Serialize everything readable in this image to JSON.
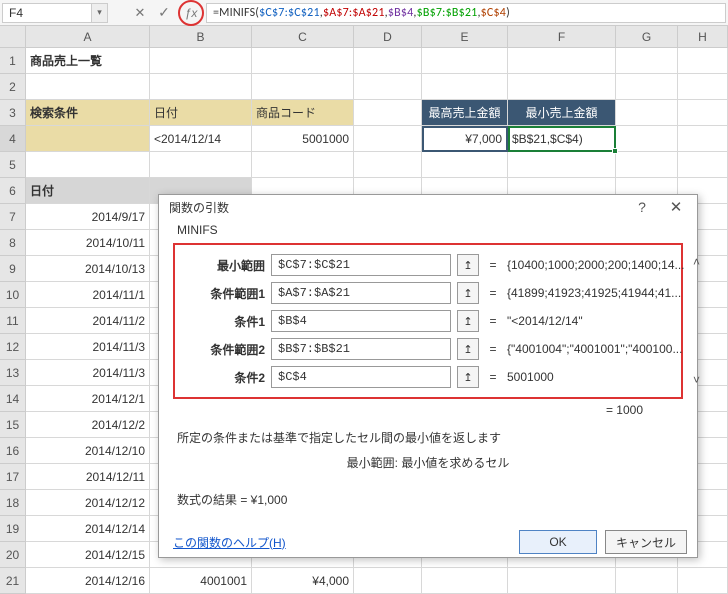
{
  "namebox": "F4",
  "formula_parts": {
    "prefix": "=MINIFS(",
    "a1": "$C$7:$C$21",
    "a2": "$A$7:$A$21",
    "a3": "$B$4",
    "a4": "$B$7:$B$21",
    "a5": "$C$4",
    "suffix": ")"
  },
  "columns": [
    "A",
    "B",
    "C",
    "D",
    "E",
    "F",
    "G",
    "H"
  ],
  "rows": {
    "1": {
      "A": "商品売上一覧"
    },
    "2": {},
    "3": {
      "A": "検索条件",
      "B": "日付",
      "C": "商品コード",
      "E": "最高売上金額",
      "F": "最小売上金額"
    },
    "4": {
      "B": "<2014/12/14",
      "C": "5001000",
      "E": "¥7,000",
      "F": "$B$21,$C$4)"
    },
    "5": {},
    "6": {
      "A": "日付"
    },
    "7": {
      "A": "2014/9/17"
    },
    "8": {
      "A": "2014/10/11"
    },
    "9": {
      "A": "2014/10/13"
    },
    "10": {
      "A": "2014/11/1"
    },
    "11": {
      "A": "2014/11/2"
    },
    "12": {
      "A": "2014/11/3"
    },
    "13": {
      "A": "2014/11/3"
    },
    "14": {
      "A": "2014/12/1"
    },
    "15": {
      "A": "2014/12/2"
    },
    "16": {
      "A": "2014/12/10"
    },
    "17": {
      "A": "2014/12/11"
    },
    "18": {
      "A": "2014/12/12"
    },
    "19": {
      "A": "2014/12/14"
    },
    "20": {
      "A": "2014/12/15"
    },
    "21": {
      "A": "2014/12/16",
      "B": "4001001",
      "C": "¥4,000"
    }
  },
  "dialog": {
    "title": "関数の引数",
    "func": "MINIFS",
    "args": [
      {
        "label": "最小範囲",
        "value": "$C$7:$C$21",
        "eval": "{10400;1000;2000;200;1400;14...",
        "chev": "up"
      },
      {
        "label": "条件範囲1",
        "value": "$A$7:$A$21",
        "eval": "{41899;41923;41925;41944;41..."
      },
      {
        "label": "条件1",
        "value": "$B$4",
        "eval": "\"<2014/12/14\""
      },
      {
        "label": "条件範囲2",
        "value": "$B$7:$B$21",
        "eval": "{\"4001004\";\"4001001\";\"400100..."
      },
      {
        "label": "条件2",
        "value": "$C$4",
        "eval": "5001000",
        "chev": "down"
      }
    ],
    "result_inline": "= 1000",
    "desc": "所定の条件または基準で指定したセル間の最小値を返します",
    "desc_sub": "最小範囲:  最小値を求めるセル",
    "result_label": "数式の結果 =  ¥1,000",
    "help": "この関数のヘルプ(H)",
    "ok": "OK",
    "cancel": "キャンセル"
  }
}
